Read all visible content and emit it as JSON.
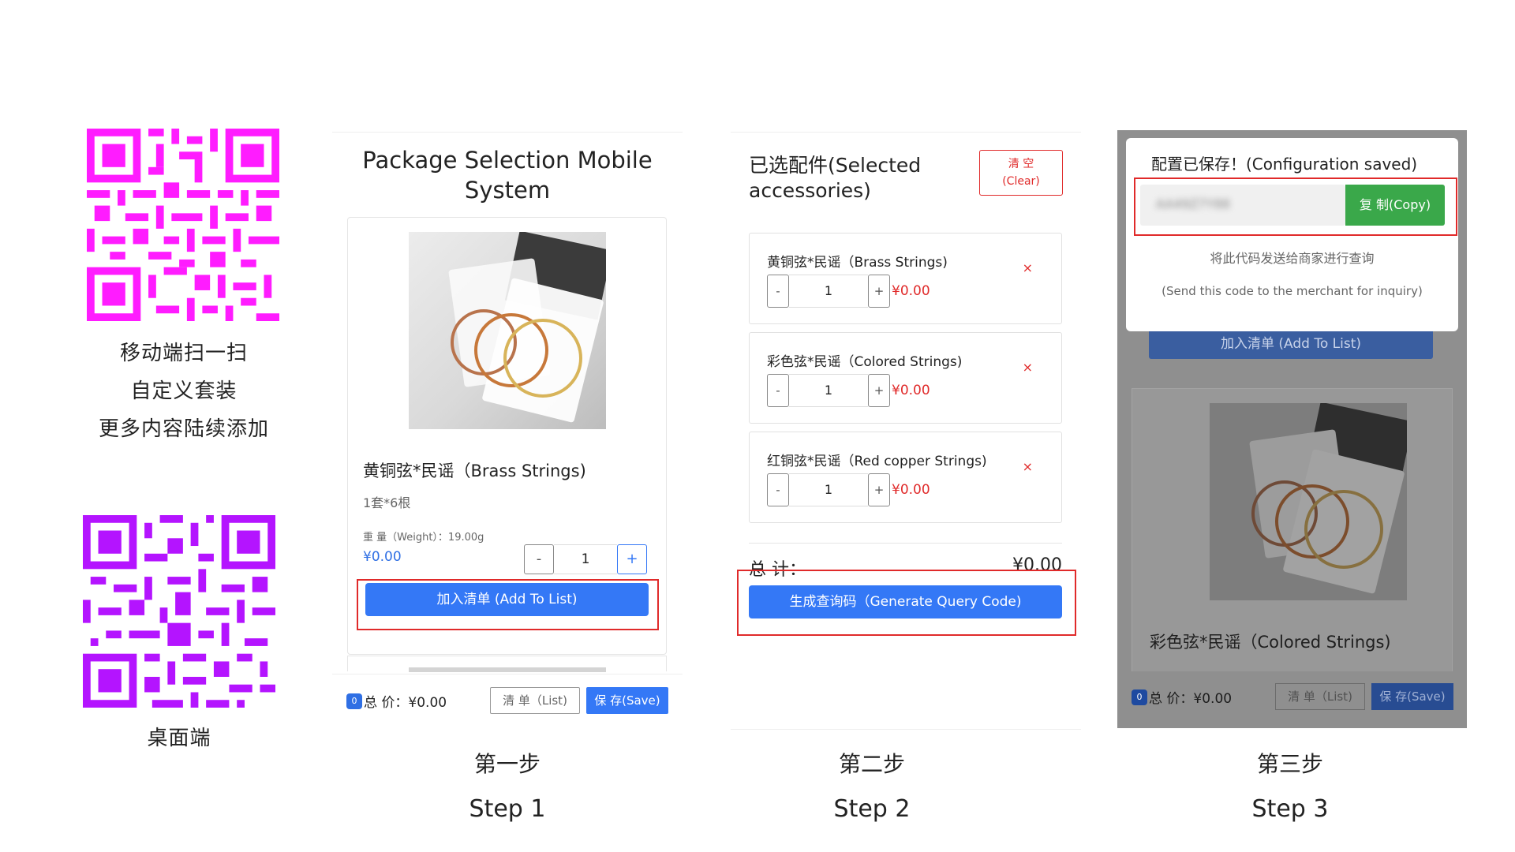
{
  "qr_sections": {
    "mobile": {
      "lines": [
        "移动端扫一扫",
        "自定义套装",
        "更多内容陆续添加"
      ],
      "color": "#ff1cff"
    },
    "desktop": {
      "label": "桌面端",
      "color": "#b414ff"
    }
  },
  "steps": [
    {
      "cn": "第一步",
      "en": "Step 1"
    },
    {
      "cn": "第二步",
      "en": "Step 2"
    },
    {
      "cn": "第三步",
      "en": "Step 3"
    }
  ],
  "panel1": {
    "title": "Package Selection Mobile System",
    "product": {
      "name": "黄铜弦*民谣（Brass Strings)",
      "spec": "1套*6根",
      "weight": "重 量（Weight）：19.00g",
      "price": "¥0.00",
      "qty_minus": "-",
      "qty_value": "1",
      "qty_plus": "+",
      "add_button": "加入清单 (Add To List)"
    },
    "footer": {
      "badge": "0",
      "total_label": "总 价：¥0.00",
      "list_button": "清 单（List)",
      "save_button": "保 存(Save)"
    }
  },
  "panel2": {
    "title": "已选配件(Selected accessories)",
    "clear_button": {
      "cn": "清 空",
      "en": "(Clear)"
    },
    "items": [
      {
        "name": "黄铜弦*民谣（Brass Strings)",
        "qty": "1",
        "price": "¥0.00",
        "remove": "×"
      },
      {
        "name": "彩色弦*民谣（Colored Strings)",
        "qty": "1",
        "price": "¥0.00",
        "remove": "×"
      },
      {
        "name": "红铜弦*民谣（Red copper Strings)",
        "qty": "1",
        "price": "¥0.00",
        "remove": "×"
      }
    ],
    "minus": "-",
    "plus": "+",
    "total_label": "总 计：",
    "total_value": "¥0.00",
    "generate_button": "生成查询码（Generate Query Code)"
  },
  "panel3": {
    "modal_title": "配置已保存！(Configuration saved)",
    "code_value": "AA49Z7Y88",
    "copy_button": "复 制(Copy)",
    "hint_cn": "将此代码发送给商家进行查询",
    "hint_en": "(Send this code to the merchant for inquiry)",
    "bg_add_button": "加入清单 (Add To List)",
    "bg_product_name": "彩色弦*民谣（Colored Strings)",
    "footer": {
      "badge": "0",
      "total_label": "总 价：¥0.00",
      "list_button": "清 单（List)",
      "save_button": "保 存(Save)"
    }
  },
  "colors": {
    "primary_blue": "#3478f6",
    "copy_green": "#3aa84a",
    "highlight_red": "#e02a2a",
    "overlay_gray": "#8f8f8f"
  }
}
